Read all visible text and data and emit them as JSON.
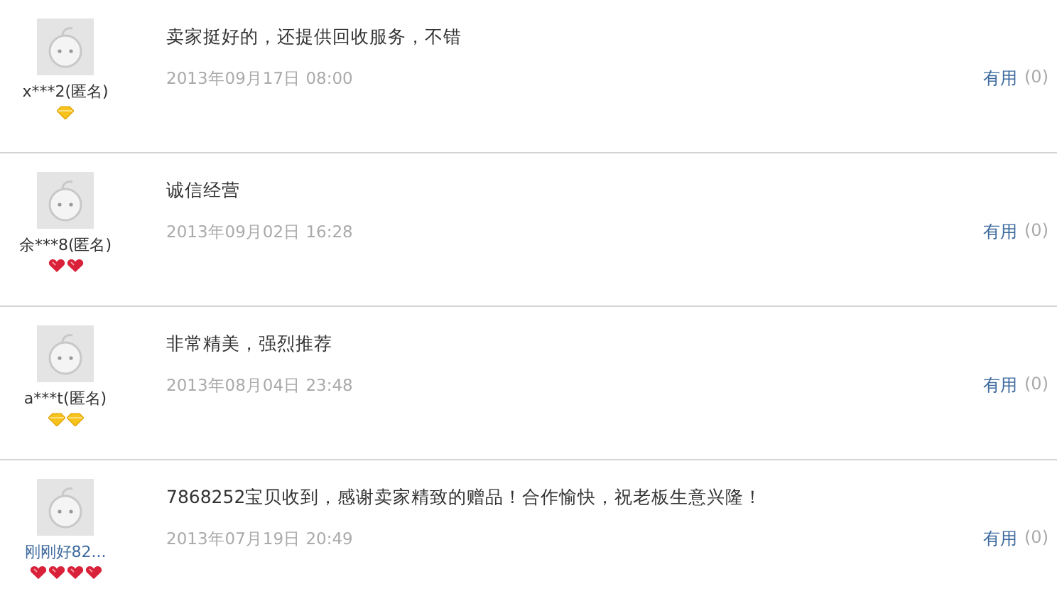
{
  "reviews": [
    {
      "user": "x***2(匿名)",
      "user_link": false,
      "badges": [
        {
          "kind": "diamond"
        }
      ],
      "comment": "卖家挺好的，还提供回收服务，不错",
      "date": "2013年09月17日 08:00",
      "helpful_label": "有用",
      "helpful_count": "(0)"
    },
    {
      "user": "余***8(匿名)",
      "user_link": false,
      "badges": [
        {
          "kind": "heart"
        },
        {
          "kind": "heart"
        }
      ],
      "comment": "诚信经营",
      "date": "2013年09月02日 16:28",
      "helpful_label": "有用",
      "helpful_count": "(0)"
    },
    {
      "user": "a***t(匿名)",
      "user_link": false,
      "badges": [
        {
          "kind": "diamond"
        },
        {
          "kind": "diamond"
        }
      ],
      "comment": "非常精美，强烈推荐",
      "date": "2013年08月04日 23:48",
      "helpful_label": "有用",
      "helpful_count": "(0)"
    },
    {
      "user": "刚刚好82...",
      "user_link": true,
      "badges": [
        {
          "kind": "heart"
        },
        {
          "kind": "heart"
        },
        {
          "kind": "heart"
        },
        {
          "kind": "heart"
        }
      ],
      "comment": "7868252宝贝收到，感谢卖家精致的赠品！合作愉快，祝老板生意兴隆！",
      "date": "2013年07月19日 20:49",
      "helpful_label": "有用",
      "helpful_count": "(0)"
    }
  ]
}
